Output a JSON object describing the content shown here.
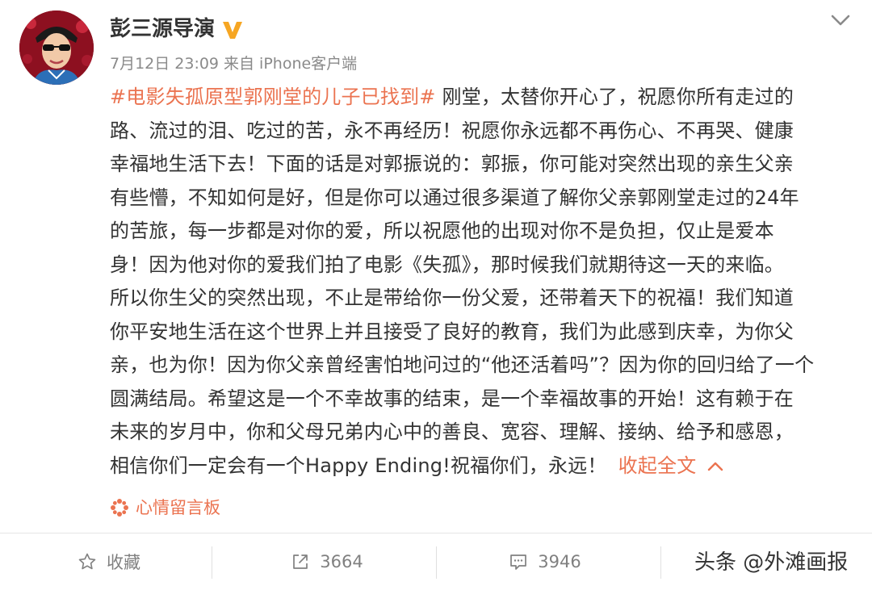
{
  "author": {
    "name": "彭三源导演",
    "verified": true,
    "verified_badge_icon": "verified-v-icon",
    "verified_color": "#f6a623"
  },
  "meta": {
    "date": "7月12日",
    "time": "23:09",
    "via": "来自",
    "client": "iPhone客户端"
  },
  "post": {
    "hashtag": "#电影失孤原型郭刚堂的儿子已找到#",
    "lines": [
      " 刚堂，太替你开心了，祝愿你所有走过的",
      "路、流过的泪、吃过的苦，永不再经历！祝愿你永远都不再伤心、不再哭、健康",
      "幸福地生活下去！下面的话是对郭振说的：郭振，你可能对突然出现的亲生父亲",
      "有些懵，不知如何是好，但是你可以通过很多渠道了解你父亲郭刚堂走过的24年",
      "的苦旅，每一步都是对你的爱，所以祝愿他的出现对你不是负担，仅止是爱本",
      "身！因为他对你的爱我们拍了电影《失孤》，那时候我们就期待这一天的来临。",
      "所以你生父的突然出现，不止是带给你一份父爱，还带着天下的祝福！我们知道",
      "你平安地生活在这个世界上并且接受了良好的教育，我们为此感到庆幸，为你父",
      "亲，也为你！因为你父亲曾经害怕地问过的“他还活着吗”？因为你的回归给了一个",
      "圆满结局。希望这是一个不幸故事的结束，是一个幸福故事的开始！这有赖于在",
      "未来的岁月中，你和父母兄弟内心中的善良、宽容、理解、接纳、给予和感恩，",
      "相信你们一定会有一个Happy Ending!祝福你们，永远！"
    ],
    "collapse_label": "收起全文",
    "accent_color": "#eb7350"
  },
  "source": {
    "label": "心情留言板",
    "icon": "flower-icon"
  },
  "actions": {
    "favorite_label": "收藏",
    "repost_count": "3664",
    "comment_count": "3946"
  },
  "watermark": "头条 @外滩画报"
}
